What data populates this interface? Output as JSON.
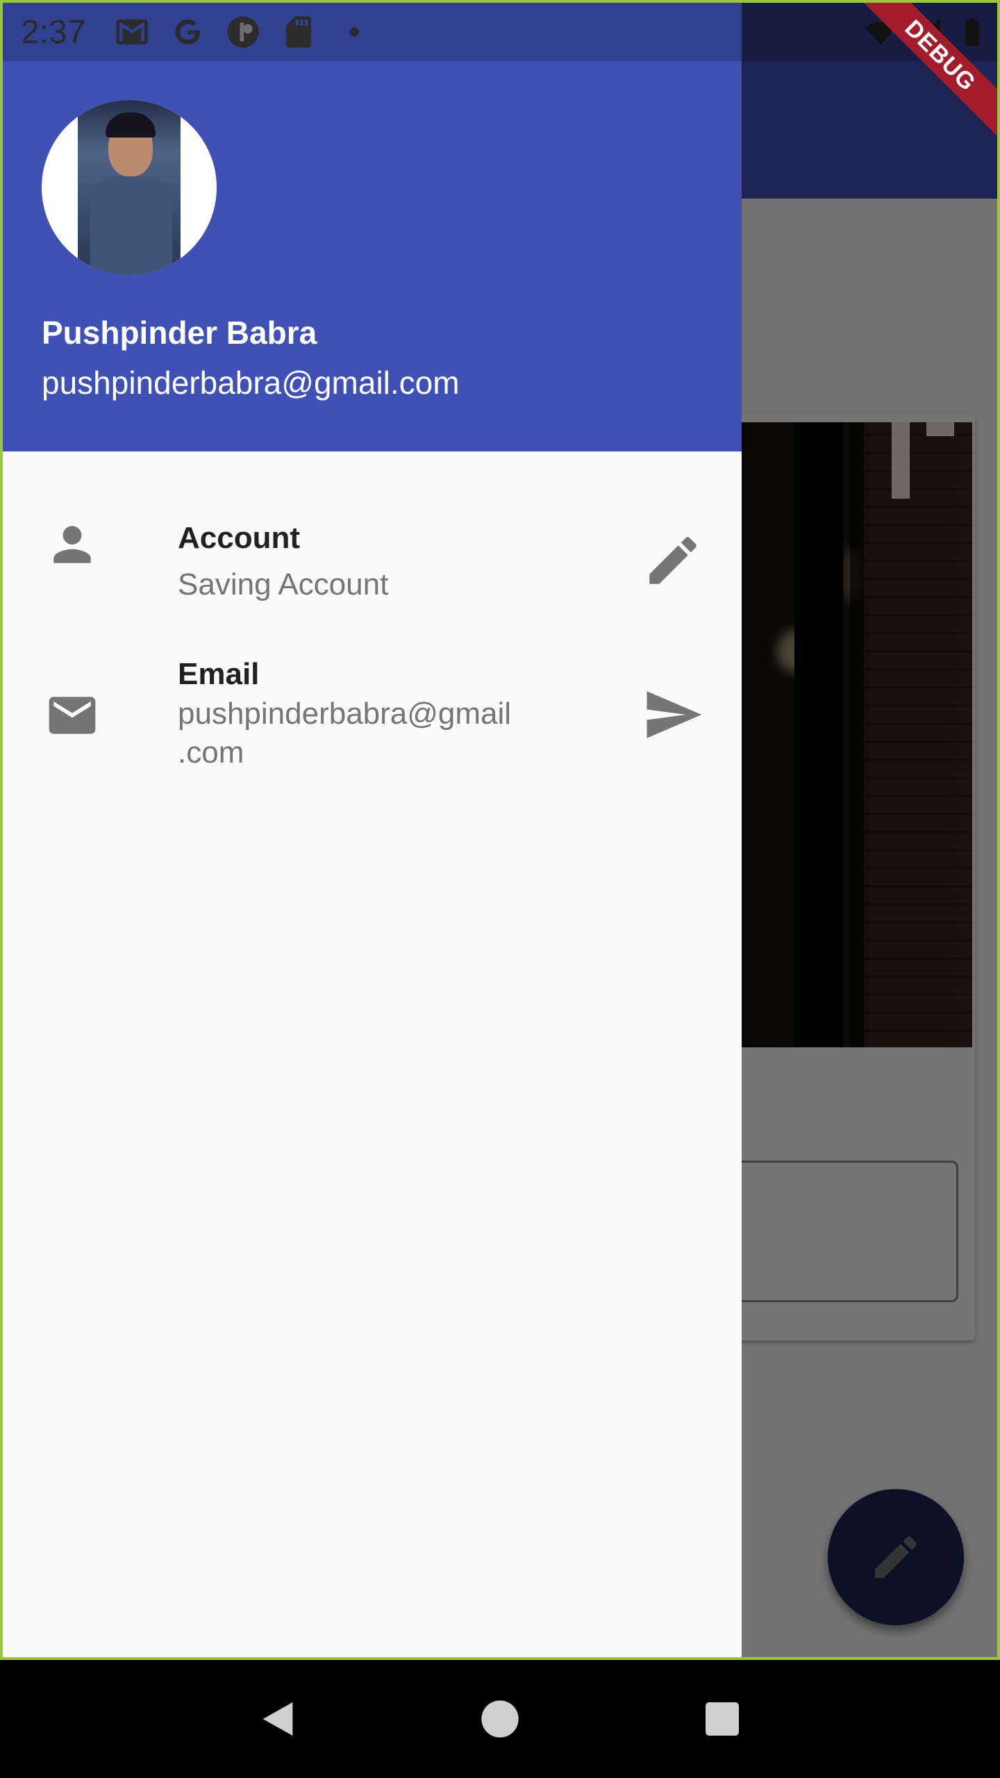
{
  "status_bar": {
    "time": "2:37",
    "icons": [
      "gmail-icon",
      "google-icon",
      "pinterest-icon",
      "sd-card-icon",
      "dot-icon"
    ],
    "right_icons": [
      "wifi-icon",
      "signal-icon",
      "battery-icon"
    ]
  },
  "debug_banner": "DEBUG",
  "drawer": {
    "header": {
      "name": "Pushpinder Babra",
      "email": "pushpinderbabra@gmail.com"
    },
    "items": [
      {
        "icon": "person-icon",
        "title": "Account",
        "subtitle": "Saving Account",
        "action_icon": "edit-icon"
      },
      {
        "icon": "mail-icon",
        "title": "Email",
        "subtitle": "pushpinderbabra@gmail\n.com",
        "action_icon": "send-icon"
      }
    ]
  },
  "fab": {
    "icon": "edit-icon"
  },
  "nav_bar": {
    "buttons": [
      "back-icon",
      "home-icon",
      "recents-icon"
    ]
  },
  "colors": {
    "primary": "#3f51b5",
    "drawer_bg": "#fafafa",
    "icon_grey": "#757575",
    "debug": "#a31c2b"
  }
}
